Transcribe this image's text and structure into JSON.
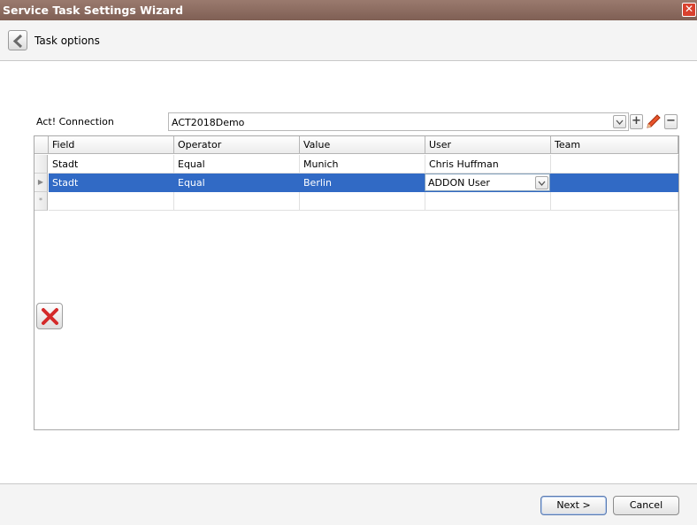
{
  "window": {
    "title": "Service Task Settings Wizard",
    "close_glyph": "✕"
  },
  "header": {
    "title": "Task options"
  },
  "connection": {
    "label": "Act! Connection",
    "value": "ACT2018Demo",
    "dropdown_icon": "chevron-down-icon",
    "add_glyph": "+",
    "remove_glyph": "−"
  },
  "grid": {
    "columns": [
      "Field",
      "Operator",
      "Value",
      "User",
      "Team"
    ],
    "rows": [
      {
        "field": "Stadt",
        "operator": "Equal",
        "value": "Munich",
        "user": "Chris Huffman",
        "team": ""
      },
      {
        "field": "Stadt",
        "operator": "Equal",
        "value": "Berlin",
        "user": "ADDON User",
        "team": "",
        "selected": true
      }
    ],
    "new_row_glyph": "*",
    "current_row_glyph": "▶"
  },
  "footer": {
    "next_label": "Next >",
    "cancel_label": "Cancel"
  },
  "colors": {
    "selection": "#316ac5",
    "titlebar": "#8b6b60",
    "delete": "#d42a2a"
  }
}
